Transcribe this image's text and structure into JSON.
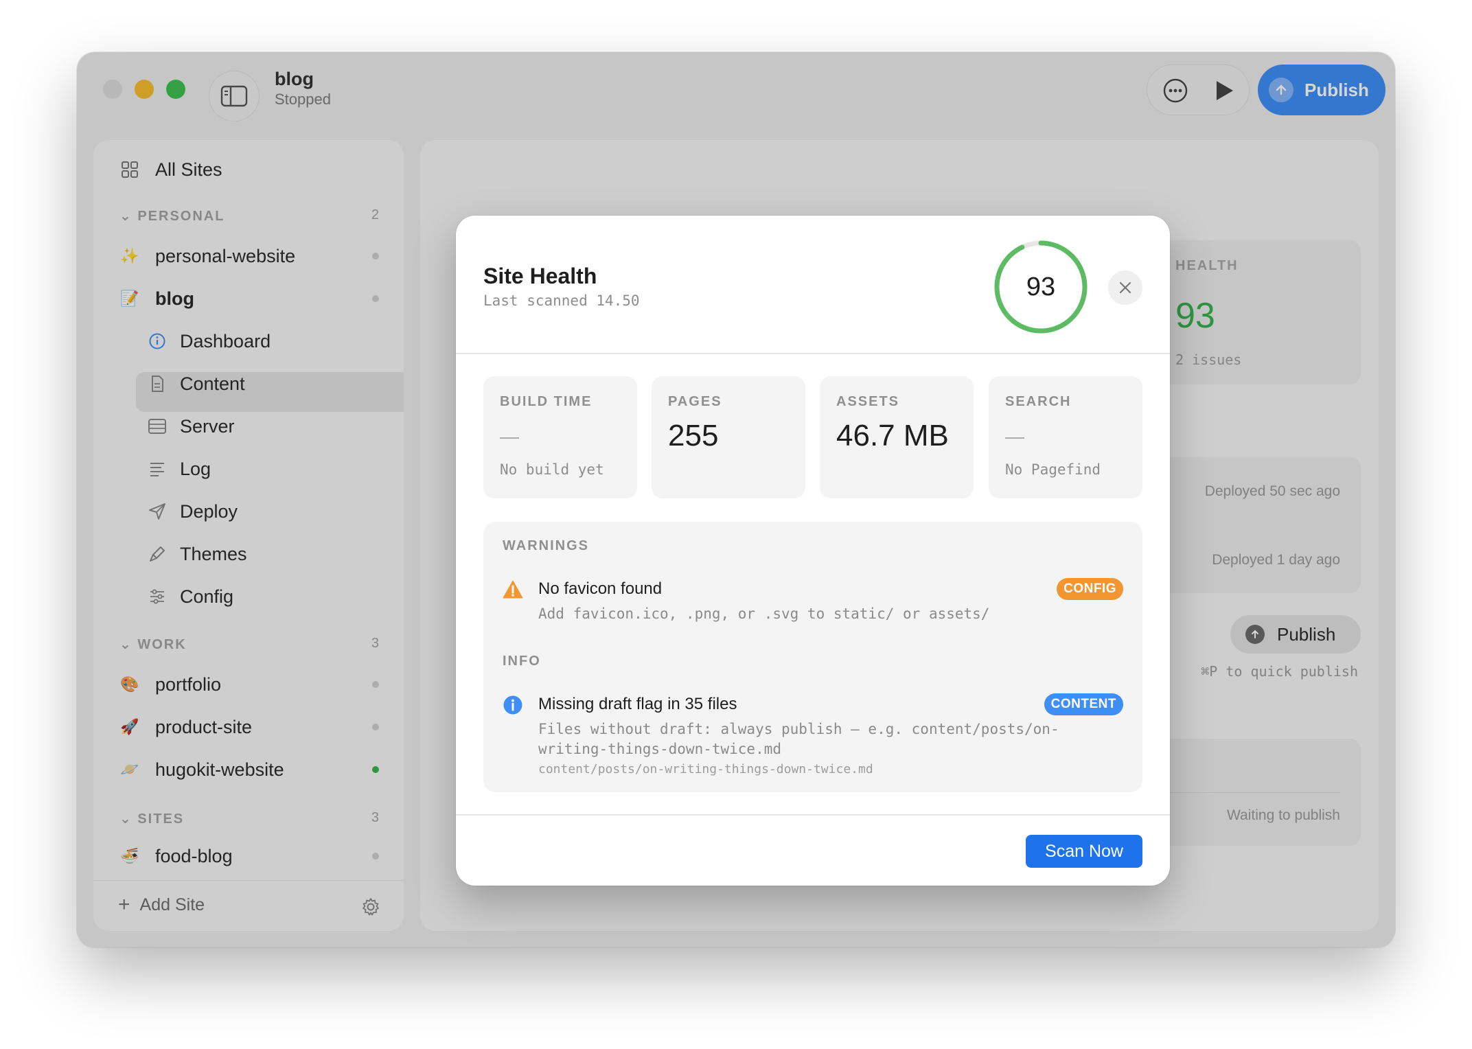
{
  "window": {
    "title": "blog",
    "status": "Stopped",
    "publish_label": "Publish"
  },
  "sidebar": {
    "all_sites": "All Sites",
    "sections": {
      "personal": {
        "label": "PERSONAL",
        "count": "2"
      },
      "work": {
        "label": "WORK",
        "count": "3"
      },
      "sites": {
        "label": "SITES",
        "count": "3"
      }
    },
    "items": {
      "personal_website": {
        "label": "personal-website",
        "emoji": "✨"
      },
      "blog": {
        "label": "blog",
        "emoji": "📝"
      },
      "portfolio": {
        "label": "portfolio",
        "emoji": "🎨"
      },
      "product_site": {
        "label": "product-site",
        "emoji": "🚀"
      },
      "hugokit_website": {
        "label": "hugokit-website",
        "emoji": "🪐"
      },
      "food_blog": {
        "label": "food-blog",
        "emoji": "🍜"
      }
    },
    "blog_nav": [
      "Dashboard",
      "Content",
      "Server",
      "Log",
      "Deploy",
      "Themes",
      "Config"
    ],
    "add_site": "Add Site"
  },
  "main": {
    "health_label": "HEALTH",
    "health_value": "93",
    "health_issues": "2 issues",
    "deploys": [
      "Deployed 50 sec ago",
      "Deployed 1 day ago"
    ],
    "publish_label": "Publish",
    "publish_hint": "⌘P to quick publish",
    "waiting": "Waiting to publish"
  },
  "modal": {
    "title": "Site Health",
    "subtitle": "Last scanned 14.50",
    "score": "93",
    "score_fraction": 0.93,
    "score_color": "#5dbb63",
    "stats": [
      {
        "label": "BUILD TIME",
        "value": "—",
        "sub": "No build yet",
        "is_dash": true
      },
      {
        "label": "PAGES",
        "value": "255",
        "sub": "",
        "is_dash": false
      },
      {
        "label": "ASSETS",
        "value": "46.7 MB",
        "sub": "",
        "is_dash": false
      },
      {
        "label": "SEARCH",
        "value": "—",
        "sub": "No Pagefind",
        "is_dash": true
      }
    ],
    "warnings_heading": "WARNINGS",
    "warning": {
      "title": "No favicon found",
      "desc": "Add favicon.ico, .png, or .svg to static/ or assets/",
      "tag": "CONFIG",
      "icon": "warning-triangle-icon"
    },
    "info_heading": "INFO",
    "info": {
      "title": "Missing draft flag in 35 files",
      "desc": "Files without draft: always publish — e.g. content/posts/on-writing-things-down-twice.md",
      "file": "content/posts/on-writing-things-down-twice.md",
      "tag": "CONTENT",
      "icon": "info-circle-icon"
    },
    "scan_label": "Scan Now"
  },
  "colors": {
    "accent": "#1f73ea",
    "publish": "#3f8ef6",
    "health_green": "#37b24d",
    "warn_orange": "#f29632"
  }
}
